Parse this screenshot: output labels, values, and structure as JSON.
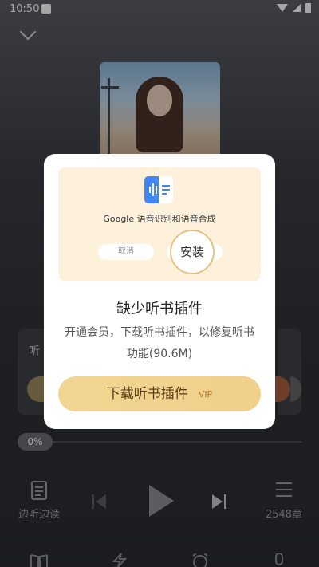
{
  "status_bar": {
    "time": "10:50"
  },
  "player": {
    "left_card_text": "听",
    "progress_label": "0%",
    "progress_fraction": 0,
    "left_control_label": "边听边读",
    "right_control_label": "2548章"
  },
  "dialog": {
    "illustration": {
      "app_name": "Google 语音识别和语音合成",
      "cancel_label": "取消",
      "install_label": "安装"
    },
    "title": "缺少听书插件",
    "description": "开通会员，下载听书插件，以修复听书功能(90.6M)",
    "download_button": "下载听书插件",
    "vip_tag": "VIP"
  },
  "colors": {
    "accent_gold": "#f0d08a",
    "google_blue": "#4285f4"
  }
}
